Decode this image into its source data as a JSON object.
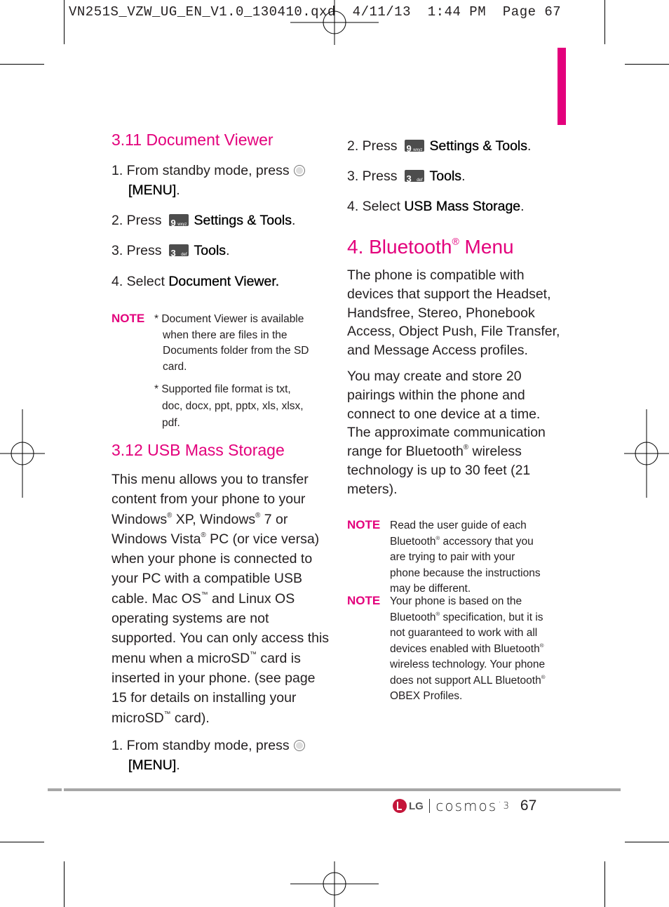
{
  "slug_line": "VN251S_VZW_UG_EN_V1.0_130410.qxd  4/11/13  1:44 PM  Page 67",
  "colors": {
    "accent": "#e3007c",
    "text": "#231f20",
    "rule": "#a6a6a6",
    "lg_red": "#c4153a"
  },
  "left_column": {
    "section_311": {
      "title": "3.11 Document Viewer",
      "steps": [
        {
          "prefix": "1. From standby mode, press",
          "icon": "menu-ok-key-icon",
          "bold": "[MENU]",
          "suffix": "."
        },
        {
          "prefix": "2. Press",
          "icon": "key-9-wxyz-icon",
          "key_num": "9",
          "key_sub": "wxyz",
          "bold": "Settings & Tools",
          "suffix": "."
        },
        {
          "prefix": "3. Press",
          "icon": "key-3-def-icon",
          "key_num": "3",
          "key_sub": "def",
          "bold": "Tools",
          "suffix": "."
        },
        {
          "prefix": "4. Select",
          "bold": "Document Viewer."
        }
      ],
      "note_label": "NOTE",
      "notes": [
        [
          "* Document Viewer is available",
          "when there are files in the",
          "Documents folder from the SD",
          "card."
        ],
        [
          "* Supported file format is  txt,",
          "doc, docx, ppt, pptx, xls, xlsx,",
          "pdf."
        ]
      ]
    },
    "section_312": {
      "title": "3.12 USB Mass Storage",
      "paragraph_lines": [
        "This menu allows you to transfer",
        "content from your phone to your",
        "Windows® XP, Windows® 7 or",
        "Windows Vista® PC (or vice versa)",
        "when your phone is connected to",
        "your PC with a compatible USB",
        "cable. Mac OS™ and Linux OS",
        "operating systems are not",
        "supported. You can only access this",
        "menu when a microSD™ card is",
        "inserted in your phone. (see page",
        "15 for details on installing your",
        "microSD™ card)."
      ],
      "step1": {
        "prefix": "1. From standby mode, press",
        "bold": "[MENU]",
        "suffix": "."
      }
    }
  },
  "right_column": {
    "steps": [
      {
        "prefix": "2. Press",
        "key_num": "9",
        "key_sub": "wxyz",
        "bold": "Settings & Tools",
        "suffix": "."
      },
      {
        "prefix": "3. Press",
        "key_num": "3",
        "key_sub": "def",
        "bold": "Tools",
        "suffix": "."
      },
      {
        "prefix": "4. Select",
        "bold": "USB Mass Storage",
        "suffix": "."
      }
    ],
    "bluetooth": {
      "title_main": "4. Bluetooth",
      "title_reg": "®",
      "title_end": " Menu",
      "para1_lines": [
        "The phone is compatible with",
        "devices that support the Headset,",
        "Handsfree, Stereo, Phonebook",
        "Access, Object Push, File Transfer,",
        "and Message Access profiles."
      ],
      "para2_lines": [
        "You may create and store 20",
        "pairings within the phone and",
        "connect to one device at a time.",
        "The approximate communication",
        "range for Bluetooth® wireless",
        "technology is up to 30 feet (21",
        "meters)."
      ],
      "note_label": "NOTE",
      "note1_lines": [
        "Read the user guide of each",
        "Bluetooth® accessory that you",
        "are trying to pair with your",
        "phone because the instructions",
        "may be different."
      ],
      "note2_lines": [
        "Your phone is based on the",
        "Bluetooth® specification, but it is",
        "not guaranteed to work with all",
        "devices enabled with Bluetooth®",
        "wireless technology. Your phone",
        "does not support ALL Bluetooth®",
        "OBEX Profiles."
      ]
    }
  },
  "footer": {
    "brand": "LG",
    "product": "cosmos",
    "product_suffix": "˙3",
    "page_number": "67"
  }
}
